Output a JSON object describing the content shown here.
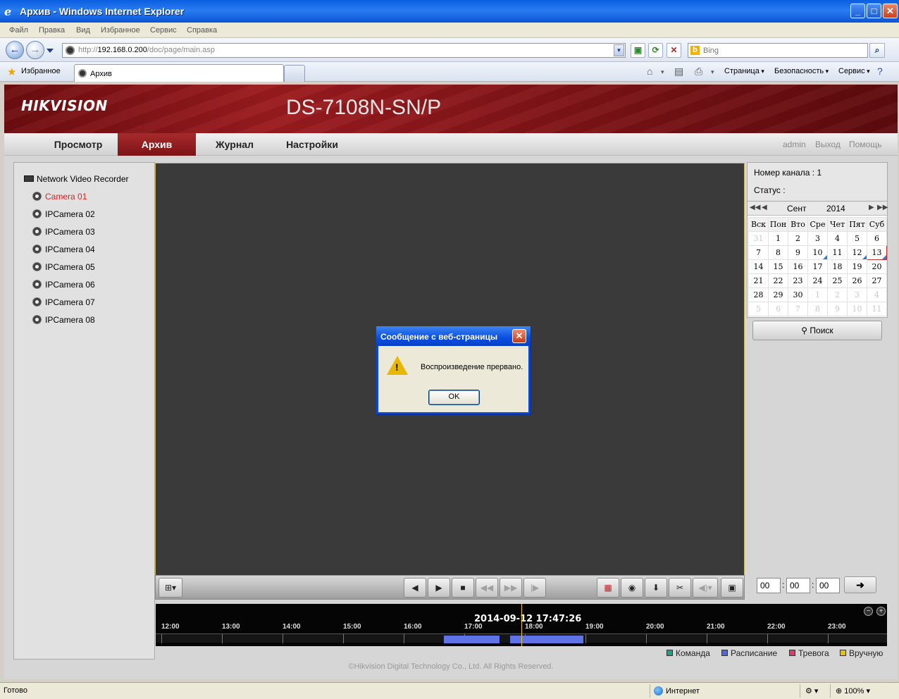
{
  "window": {
    "title": "Архив - Windows Internet Explorer",
    "minimize": "_",
    "maximize": "□",
    "close": "✕"
  },
  "menu": [
    "Файл",
    "Правка",
    "Вид",
    "Избранное",
    "Сервис",
    "Справка"
  ],
  "address": {
    "scheme": "http://",
    "host": "192.168.0.200",
    "path": "/doc/page/main.asp"
  },
  "search": {
    "placeholder": "Bing"
  },
  "favorites": {
    "label": "Избранное",
    "tab_title": "Архив"
  },
  "commands": [
    "Страница",
    "Безопасность",
    "Сервис"
  ],
  "app": {
    "logo": "HIKVISION",
    "model": "DS-7108N-SN/P",
    "nav": [
      "Просмотр",
      "Архив",
      "Журнал",
      "Настройки"
    ],
    "active_nav": "Архив",
    "nav_right": [
      "admin",
      "Выход",
      "Помощь"
    ]
  },
  "tree": {
    "root": "Network Video Recorder",
    "cameras": [
      "Camera 01",
      "IPCamera 02",
      "IPCamera 03",
      "IPCamera 04",
      "IPCamera 05",
      "IPCamera 06",
      "IPCamera 07",
      "IPCamera 08"
    ],
    "active_camera": "Camera 01"
  },
  "channel": {
    "number_label": "Номер канала : 1",
    "status_label": "Статус :"
  },
  "calendar": {
    "month": "Сент",
    "year": "2014",
    "weekdays": [
      "Вск",
      "Пон",
      "Вто",
      "Сре",
      "Чет",
      "Пят",
      "Суб"
    ],
    "weeks": [
      [
        "31",
        "1",
        "2",
        "3",
        "4",
        "5",
        "6"
      ],
      [
        "7",
        "8",
        "9",
        "10",
        "11",
        "12",
        "13"
      ],
      [
        "14",
        "15",
        "16",
        "17",
        "18",
        "19",
        "20"
      ],
      [
        "21",
        "22",
        "23",
        "24",
        "25",
        "26",
        "27"
      ],
      [
        "28",
        "29",
        "30",
        "1",
        "2",
        "3",
        "4"
      ],
      [
        "5",
        "6",
        "7",
        "8",
        "9",
        "10",
        "11"
      ]
    ],
    "selected_day": "13",
    "record_days": [
      "10",
      "12",
      "13"
    ]
  },
  "search_button": "Поиск",
  "time_input": {
    "h": "00",
    "m": "00",
    "s": "00"
  },
  "timeline": {
    "current": "2014-09-12 17:47:26",
    "hours": [
      "12:00",
      "13:00",
      "14:00",
      "15:00",
      "16:00",
      "17:00",
      "18:00",
      "19:00",
      "20:00",
      "21:00",
      "22:00",
      "23:00"
    ],
    "records": [
      {
        "start": "16:40",
        "end": "17:35"
      },
      {
        "start": "17:45",
        "end": "18:58"
      }
    ]
  },
  "legend": [
    {
      "label": "Команда",
      "color": "#20a080"
    },
    {
      "label": "Расписание",
      "color": "#5066e0"
    },
    {
      "label": "Тревога",
      "color": "#e03a6a"
    },
    {
      "label": "Вручную",
      "color": "#e8c000"
    }
  ],
  "copyright": "©Hikvision Digital Technology Co., Ltd. All Rights Reserved.",
  "dialog": {
    "title": "Сообщение с веб-страницы",
    "message": "Воспроизведение прервано.",
    "ok": "OK"
  },
  "status": {
    "left": "Готово",
    "zone": "Интернет",
    "zoom": "100%"
  },
  "colors": {
    "header_red": "#8b1518",
    "active_tab": "#8e1c1f",
    "record_bar": "#6073e6",
    "cursor": "#f0c020"
  }
}
